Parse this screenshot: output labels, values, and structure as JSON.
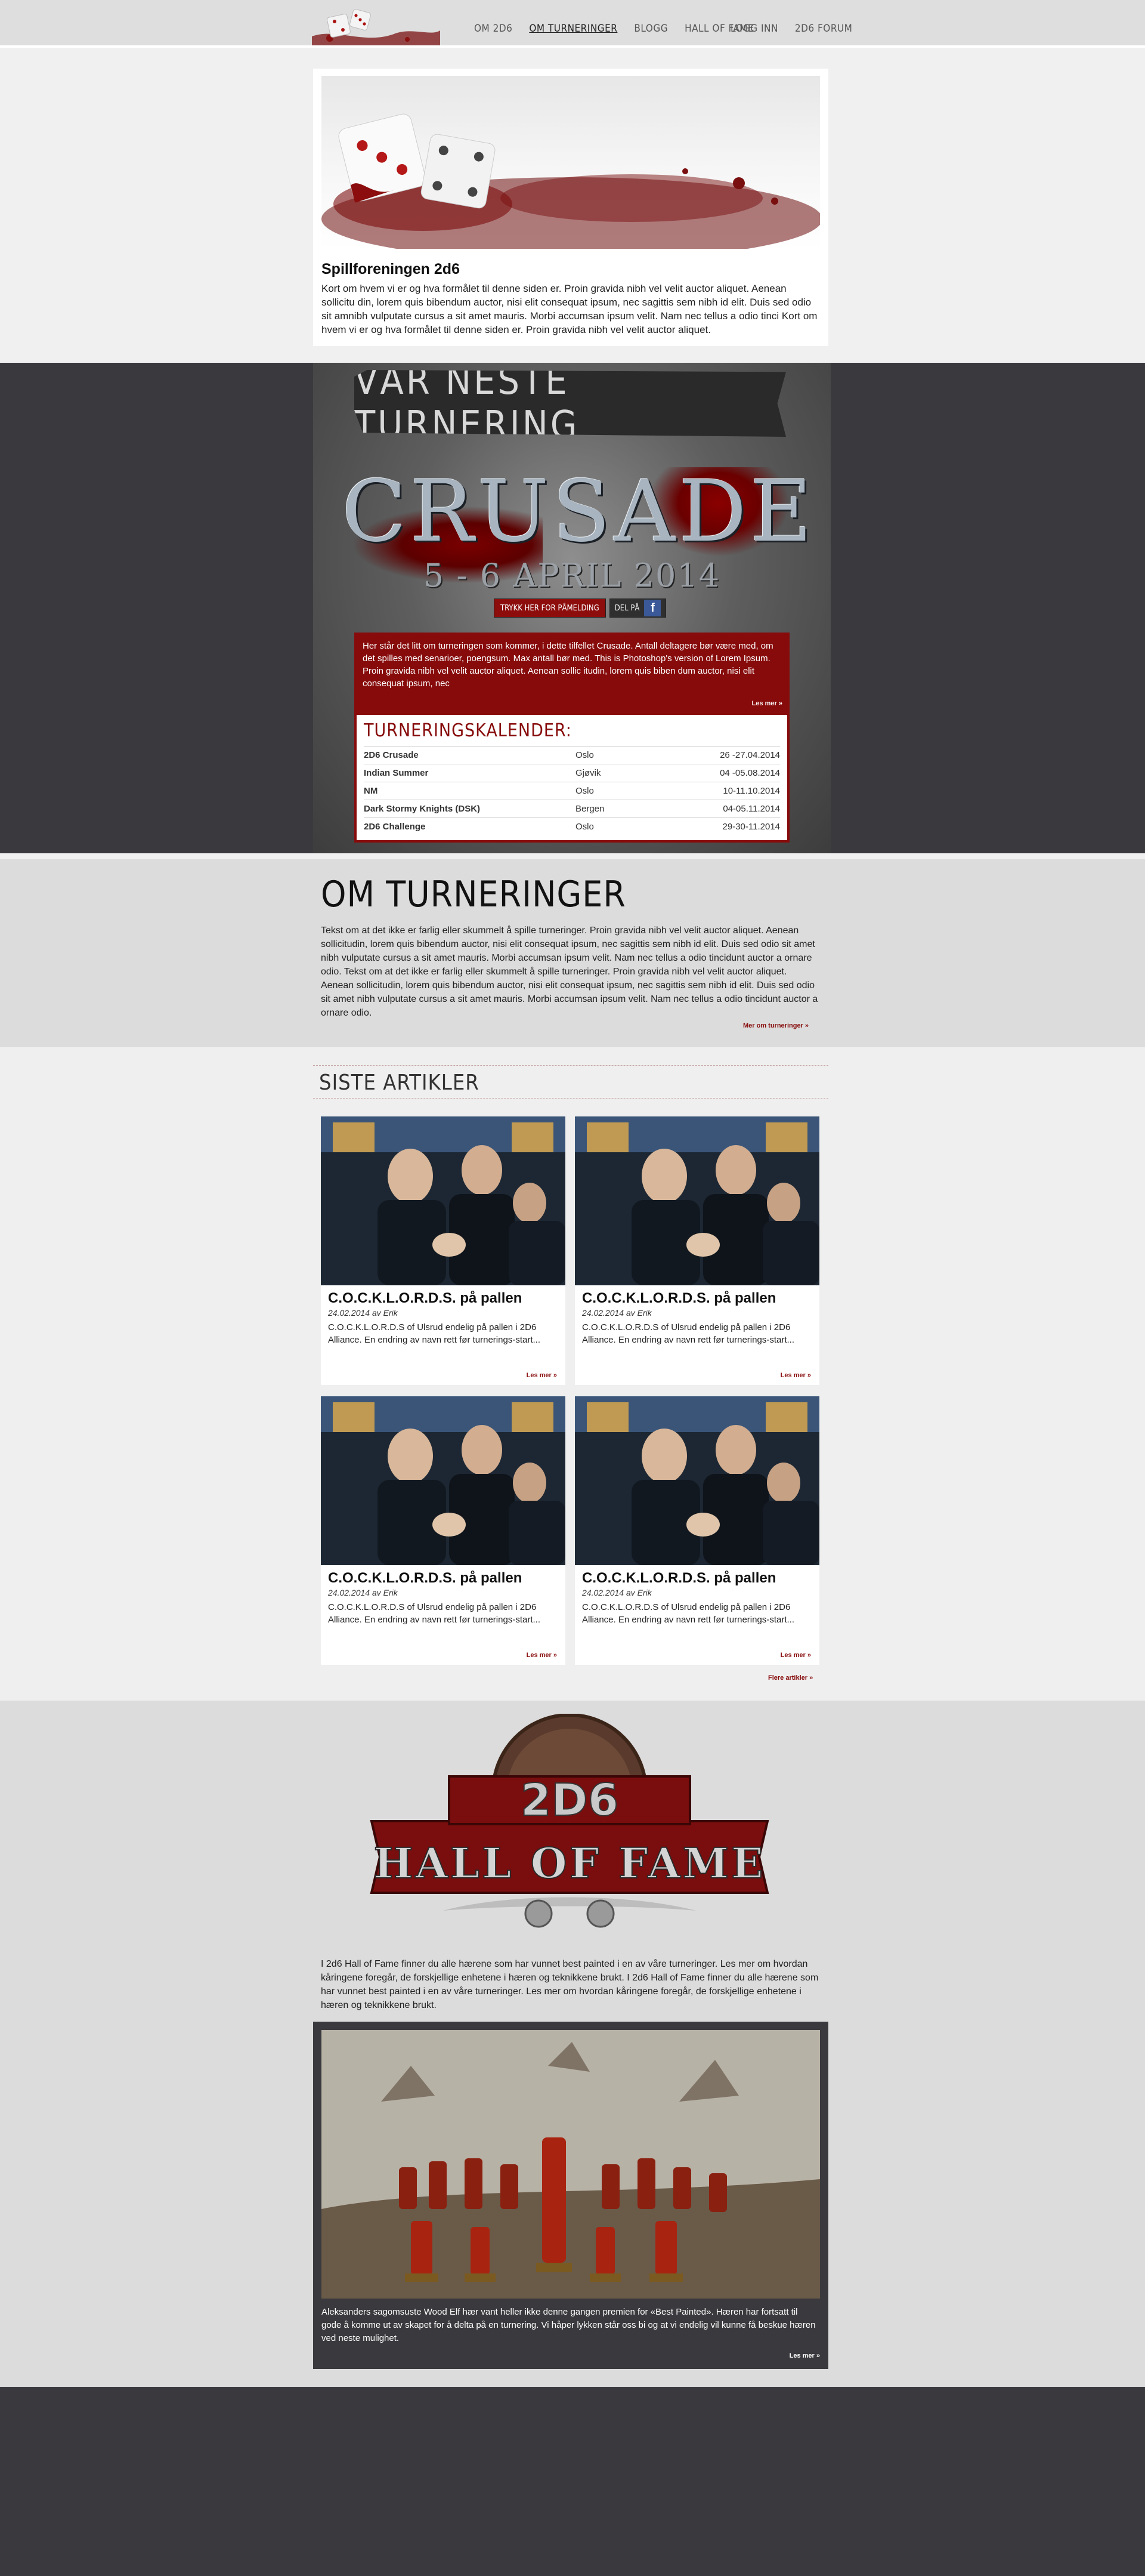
{
  "nav": {
    "left": [
      "OM 2D6",
      "OM TURNERINGER",
      "BLOGG",
      "HALL OF FAME"
    ],
    "right": [
      "LOGG INN",
      "2D6 FORUM"
    ]
  },
  "intro": {
    "title": "Spillforeningen 2d6",
    "text": "Kort om hvem vi er og hva formålet til denne siden er. Proin gravida nibh vel velit auctor aliquet. Aenean sollicitu din, lorem quis bibendum auctor, nisi elit consequat ipsum, nec sagittis sem nibh id elit. Duis sed odio sit amnibh vulputate cursus a sit amet mauris. Morbi accumsan ipsum velit. Nam nec tellus a odio tinci Kort om hvem vi er og hva formålet til denne siden er. Proin gravida nibh vel velit auctor aliquet."
  },
  "tournament": {
    "banner": "VÅR NESTE TURNERING",
    "event_name": "CRUSADE",
    "event_date": "5 - 6 APRIL 2014",
    "signup_label": "TRYKK HER FOR PÅMELDING",
    "share_label": "DEL PÅ",
    "description": "Her står det litt om turneringen som kommer, i dette tilfellet Crusade. Antall deltagere bør være med, om det spilles med senarioer, poengsum. Max antall bør med. This is Photoshop's version of Lorem Ipsum. Proin gravida nibh vel velit auctor aliquet. Aenean sollic itudin, lorem quis biben dum auctor, nisi elit consequat ipsum, nec",
    "more_label": "Les mer »",
    "calendar_title": "TURNERINGSKALENDER:",
    "calendar": [
      {
        "name": "2D6 Crusade",
        "place": "Oslo",
        "date": "26 -27.04.2014"
      },
      {
        "name": "Indian Summer",
        "place": "Gjøvik",
        "date": "04 -05.08.2014"
      },
      {
        "name": "NM",
        "place": "Oslo",
        "date": "10-11.10.2014"
      },
      {
        "name": "Dark Stormy Knights (DSK)",
        "place": "Bergen",
        "date": "04-05.11.2014"
      },
      {
        "name": "2D6 Challenge",
        "place": "Oslo",
        "date": "29-30-11.2014"
      }
    ]
  },
  "about": {
    "title": "OM TURNERINGER",
    "text": "Tekst om at det ikke er farlig eller skummelt å spille turneringer. Proin gravida nibh vel velit auctor aliquet. Aenean sollicitudin, lorem quis bibendum auctor, nisi elit consequat ipsum, nec sagittis sem nibh id elit. Duis sed odio sit amet nibh vulputate cursus a sit amet mauris. Morbi accumsan ipsum velit. Nam nec tellus a odio tincidunt auctor a ornare odio. Tekst om at det ikke er farlig eller skummelt å spille turneringer. Proin gravida nibh vel velit auctor aliquet. Aenean sollicitudin, lorem quis bibendum auctor, nisi elit consequat ipsum, nec sagittis sem nibh id elit. Duis sed odio sit amet nibh vulputate cursus a sit amet mauris. Morbi accumsan ipsum velit. Nam nec tellus a odio tincidunt auctor a ornare odio.",
    "more_label": "Mer om turneringer »"
  },
  "articles": {
    "title": "SISTE ARTIKLER",
    "items": [
      {
        "title": "C.O.C.K.L.O.R.D.S. på pallen",
        "meta": "24.02.2014 av Erik",
        "text": "C.O.C.K.L.O.R.D.S of Ulsrud endelig på pallen i 2D6 Alliance. En endring av navn rett før turnerings-start...",
        "more": "Les mer »"
      },
      {
        "title": "C.O.C.K.L.O.R.D.S. på pallen",
        "meta": "24.02.2014 av Erik",
        "text": "C.O.C.K.L.O.R.D.S of Ulsrud endelig på pallen i 2D6 Alliance. En endring av navn rett før turnerings-start...",
        "more": "Les mer »"
      },
      {
        "title": "C.O.C.K.L.O.R.D.S. på pallen",
        "meta": "24.02.2014 av Erik",
        "text": "C.O.C.K.L.O.R.D.S of Ulsrud endelig på pallen i 2D6 Alliance. En endring av navn rett før turnerings-start...",
        "more": "Les mer »"
      },
      {
        "title": "C.O.C.K.L.O.R.D.S. på pallen",
        "meta": "24.02.2014 av Erik",
        "text": "C.O.C.K.L.O.R.D.S of Ulsrud endelig på pallen i 2D6 Alliance. En endring av navn rett før turnerings-start...",
        "more": "Les mer »"
      }
    ],
    "more_label": "Flere artikler »"
  },
  "hof": {
    "logo_top": "2D6",
    "logo_bottom": "HALL OF FAME",
    "logo_of": "OF",
    "text": "I 2d6 Hall of Fame finner du alle hærene som har vunnet best painted i en av våre turneringer. Les mer om hvordan kåringene foregår, de forskjellige enhetene i hæren og teknikkene brukt. I 2d6 Hall of Fame finner du alle hærene som har vunnet best painted i en av våre turneringer. Les mer om hvordan kåringene foregår, de forskjellige enhetene i hæren og teknikkene brukt.",
    "caption": "Aleksanders sagomsuste Wood Elf hær vant heller ikke denne gangen premien for «Best Painted». Hæren har fortsatt til gode å komme ut av skapet for å delta på en turnering. Vi håper lykken står oss bi og at vi endelig vil kunne få beskue hæren ved neste mulighet.",
    "more_label": "Les mer »"
  },
  "colors": {
    "accent": "#870b0b",
    "dark": "#3a393d",
    "light": "#dcdcdc"
  }
}
